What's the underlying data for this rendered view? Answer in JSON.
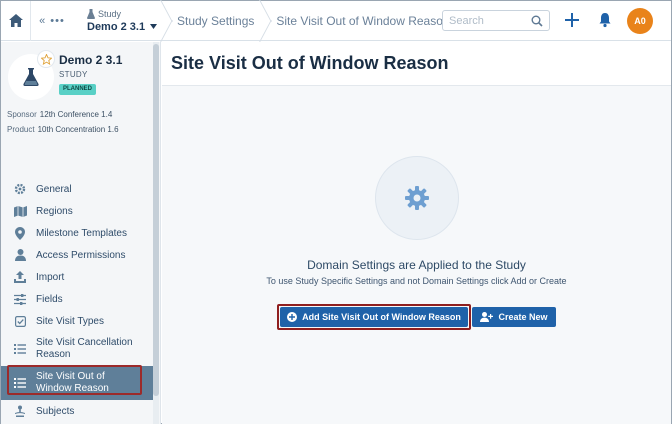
{
  "topbar": {
    "back_label": "«  •••",
    "study_label": "Study",
    "study_value": "Demo 2 3.1",
    "crumbs": [
      "Study Settings",
      "Site Visit Out of Window Reason"
    ],
    "search_placeholder": "Search",
    "avatar_initials": "A0"
  },
  "sidebar": {
    "study_name": "Demo 2 3.1",
    "study_type": "STUDY",
    "status": "PLANNED",
    "sponsor_label": "Sponsor",
    "sponsor_value": "12th Conference 1.4",
    "product_label": "Product",
    "product_value": "10th Concentration 1.6",
    "items": [
      {
        "label": "General",
        "icon": "gear-icon"
      },
      {
        "label": "Regions",
        "icon": "map-icon"
      },
      {
        "label": "Milestone Templates",
        "icon": "map-pin-icon"
      },
      {
        "label": "Access Permissions",
        "icon": "user-icon"
      },
      {
        "label": "Import",
        "icon": "upload-icon"
      },
      {
        "label": "Fields",
        "icon": "sliders-icon"
      },
      {
        "label": "Site Visit Types",
        "icon": "checkbox-icon"
      },
      {
        "label": "Site Visit Cancellation Reason",
        "icon": "list-icon"
      },
      {
        "label": "Site Visit Out of Window Reason",
        "icon": "list-icon"
      },
      {
        "label": "Subjects",
        "icon": "subjects-icon"
      }
    ],
    "active_index": 8
  },
  "main": {
    "title": "Site Visit Out of Window Reason",
    "empty_title": "Domain Settings are Applied to the Study",
    "empty_subtitle": "To use Study Specific Settings and not Domain Settings click Add or Create",
    "add_button": "Add Site Visit Out of Window Reason",
    "create_button": "Create New"
  },
  "colors": {
    "primary_button": "#1f62a9",
    "active_nav": "#5f7f99",
    "status_badge": "#59d0c6",
    "avatar": "#e9831a",
    "highlight_outline": "#9c2a2a"
  }
}
